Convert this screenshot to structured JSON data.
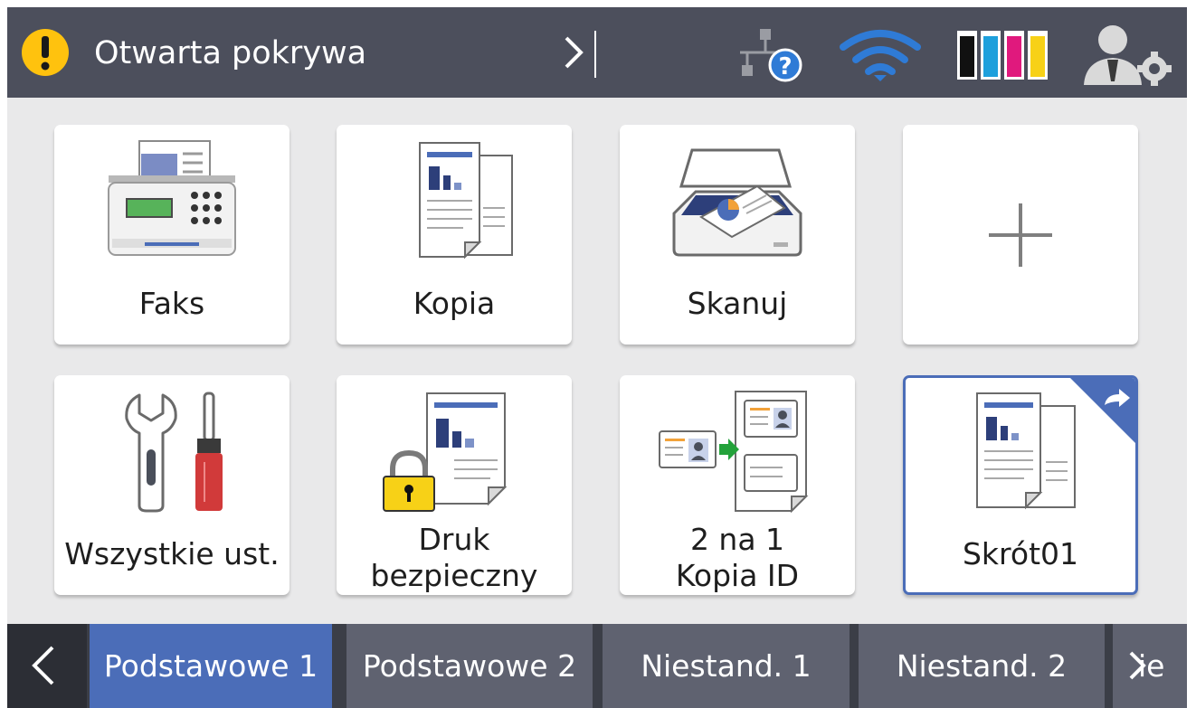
{
  "header": {
    "status_text": "Otwarta pokrywa",
    "status_icon": "warning-icon",
    "colors": {
      "background": "#4c4f5c",
      "warning": "#ffc20e",
      "wifi": "#2f7bd6"
    }
  },
  "tiles": [
    {
      "label": "Faks",
      "icon": "fax-icon"
    },
    {
      "label": "Kopia",
      "icon": "copy-icon"
    },
    {
      "label": "Skanuj",
      "icon": "scan-icon"
    },
    {
      "label": "+",
      "icon": "add-shortcut-icon"
    },
    {
      "label": "Wszystkie ust.",
      "icon": "tools-icon"
    },
    {
      "label_line1": "Druk",
      "label_line2": "bezpieczny",
      "icon": "secure-print-icon"
    },
    {
      "label_line1": "2 na 1",
      "label_line2": "Kopia ID",
      "icon": "id-copy-icon"
    },
    {
      "label": "Skrót01",
      "icon": "shortcut-copy-icon",
      "selected": true
    }
  ],
  "tabs": [
    {
      "label": "Podstawowe 1",
      "active": true
    },
    {
      "label": "Podstawowe 2",
      "active": false
    },
    {
      "label": "Niestand. 1",
      "active": false
    },
    {
      "label": "Niestand. 2",
      "active": false
    }
  ],
  "tab_next_partial": "ie",
  "accent_color": "#4b6db8"
}
